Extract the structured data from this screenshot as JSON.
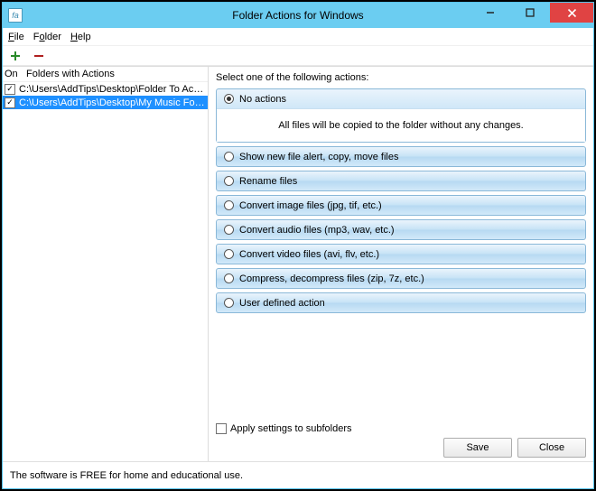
{
  "window": {
    "title": "Folder Actions for Windows",
    "icon_text": "fa"
  },
  "menus": [
    {
      "label": "File",
      "accel": "F"
    },
    {
      "label": "Folder",
      "accel": "o"
    },
    {
      "label": "Help",
      "accel": "H"
    }
  ],
  "left": {
    "header_on": "On",
    "header_path": "Folders with Actions",
    "rows": [
      {
        "checked": true,
        "selected": false,
        "path": "C:\\Users\\AddTips\\Desktop\\Folder To Actions Tes..."
      },
      {
        "checked": true,
        "selected": true,
        "path": "C:\\Users\\AddTips\\Desktop\\My Music Folder"
      }
    ]
  },
  "right": {
    "prompt": "Select one of the following actions:",
    "actions": [
      {
        "label": "No actions",
        "selected": true,
        "detail": "All files will be copied to the folder without any changes."
      },
      {
        "label": "Show new file alert, copy, move files",
        "selected": false
      },
      {
        "label": "Rename files",
        "selected": false
      },
      {
        "label": "Convert image files (jpg, tif, etc.)",
        "selected": false
      },
      {
        "label": "Convert audio files (mp3, wav, etc.)",
        "selected": false
      },
      {
        "label": "Convert video files (avi, flv, etc.)",
        "selected": false
      },
      {
        "label": "Compress, decompress files (zip, 7z, etc.)",
        "selected": false
      },
      {
        "label": "User defined action",
        "selected": false
      }
    ],
    "apply_label": "Apply settings to subfolders"
  },
  "buttons": {
    "save": "Save",
    "close": "Close"
  },
  "footer": {
    "free_text": "The software is FREE for home and educational use."
  }
}
